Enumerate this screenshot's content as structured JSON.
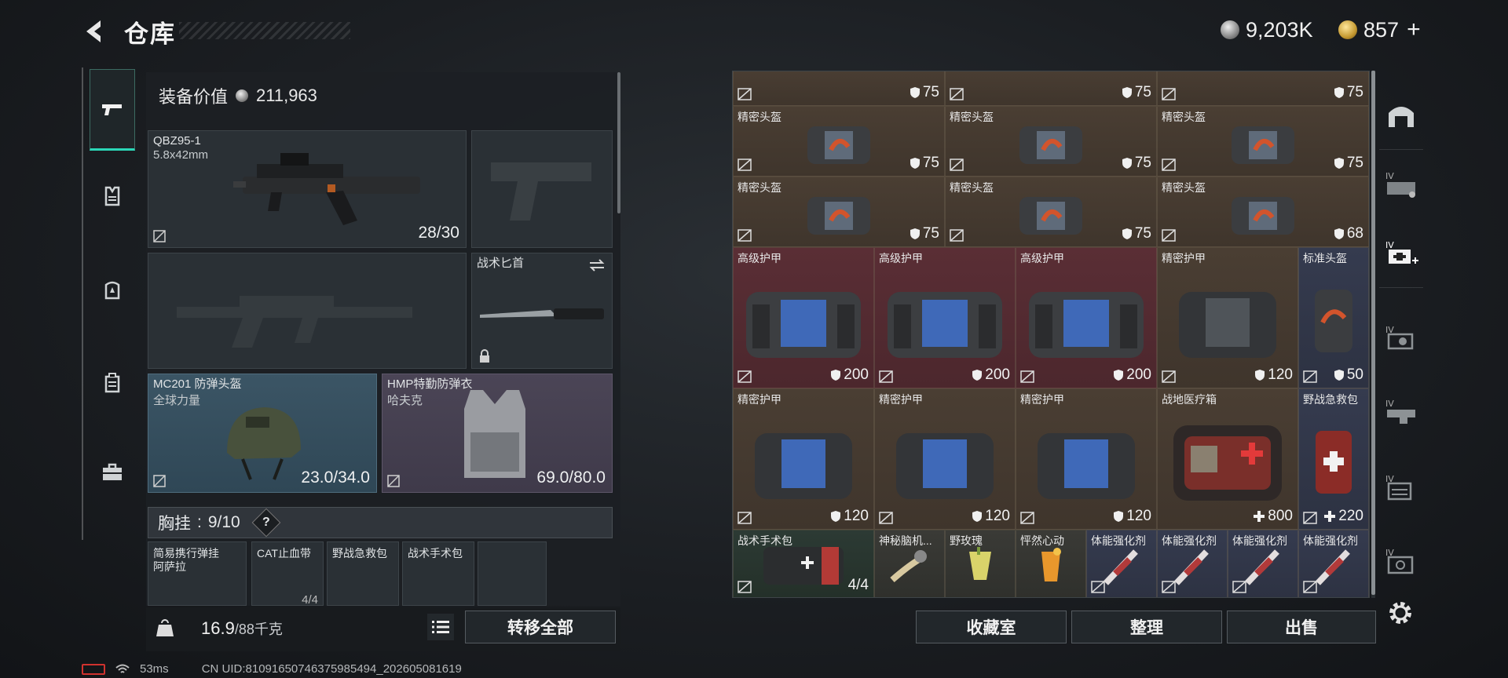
{
  "header": {
    "title": "仓库",
    "currency_silver": "9,203K",
    "currency_gold": "857",
    "gold_plus": "+"
  },
  "left": {
    "equip_value_label": "装备价值",
    "equip_value": "211,963",
    "primary_weapon": {
      "name": "QBZ95-1",
      "ammo_type": "5.8x42mm",
      "count": "28/30"
    },
    "knife": {
      "name": "战术匕首"
    },
    "helmet": {
      "name": "MC201 防弹头盔",
      "maker": "全球力量",
      "durability": "23.0/34.0"
    },
    "armor": {
      "name": "HMP特勤防弹衣",
      "maker": "哈夫克",
      "durability": "69.0/80.0"
    },
    "chest_rig": {
      "label": "胸挂",
      "sep": ":",
      "capacity": "9/10",
      "help": "?"
    },
    "chest_items": [
      {
        "name": "简易携行弹挂\n阿萨拉"
      },
      {
        "name": "CAT止血带",
        "count": "4/4"
      },
      {
        "name": "野战急救包"
      },
      {
        "name": "战术手术包"
      }
    ],
    "weight": "16.9",
    "weight_max": "/88千克",
    "transfer_all": "转移全部"
  },
  "grid": {
    "rows": [
      [
        {
          "name": "",
          "value": "75",
          "color": "brown"
        },
        {
          "name": "",
          "value": "75",
          "color": "brown"
        },
        {
          "name": "",
          "value": "75",
          "color": "brown"
        }
      ],
      [
        {
          "name": "精密头盔",
          "value": "75",
          "color": "brown"
        },
        {
          "name": "精密头盔",
          "value": "75",
          "color": "brown"
        },
        {
          "name": "精密头盔",
          "value": "75",
          "color": "brown"
        }
      ],
      [
        {
          "name": "精密头盔",
          "value": "75",
          "color": "brown"
        },
        {
          "name": "精密头盔",
          "value": "75",
          "color": "brown"
        },
        {
          "name": "精密头盔",
          "value": "68",
          "color": "brown"
        }
      ]
    ],
    "armors_row1": [
      {
        "name": "高级护甲",
        "value": "200",
        "color": "red"
      },
      {
        "name": "高级护甲",
        "value": "200",
        "color": "red"
      },
      {
        "name": "高级护甲",
        "value": "200",
        "color": "red"
      },
      {
        "name": "精密护甲",
        "value": "120",
        "color": "brown"
      }
    ],
    "std_helmet": {
      "name": "标准头盔",
      "value": "50",
      "color": "blue"
    },
    "armors_row2": [
      {
        "name": "精密护甲",
        "value": "120",
        "color": "brown"
      },
      {
        "name": "精密护甲",
        "value": "120",
        "color": "brown"
      },
      {
        "name": "精密护甲",
        "value": "120",
        "color": "brown"
      }
    ],
    "medbox": {
      "name": "战地医疗箱",
      "value": "800"
    },
    "firstaid": {
      "name": "野战急救包",
      "value": "220"
    },
    "bottom_row": [
      {
        "name": "战术手术包",
        "value": "4/4",
        "color": "green"
      },
      {
        "name": "神秘脑机...",
        "color": "dark"
      },
      {
        "name": "野玫瑰",
        "color": "dark"
      },
      {
        "name": "怦然心动",
        "color": "dark"
      },
      {
        "name": "体能强化剂",
        "color": "blue"
      },
      {
        "name": "体能强化剂",
        "color": "blue"
      },
      {
        "name": "体能强化剂",
        "color": "blue"
      },
      {
        "name": "体能强化剂",
        "color": "blue"
      }
    ]
  },
  "bottom_buttons": {
    "collection": "收藏室",
    "sort": "整理",
    "sell": "出售"
  },
  "status": {
    "ping": "53ms",
    "uid": "CN UID:81091650746375985494_202605081619"
  },
  "colors": {
    "accent": "#2bd7b7",
    "cell_brown": "#4a3e33",
    "cell_red": "#5a2e35",
    "cell_blue": "#353b4f"
  }
}
